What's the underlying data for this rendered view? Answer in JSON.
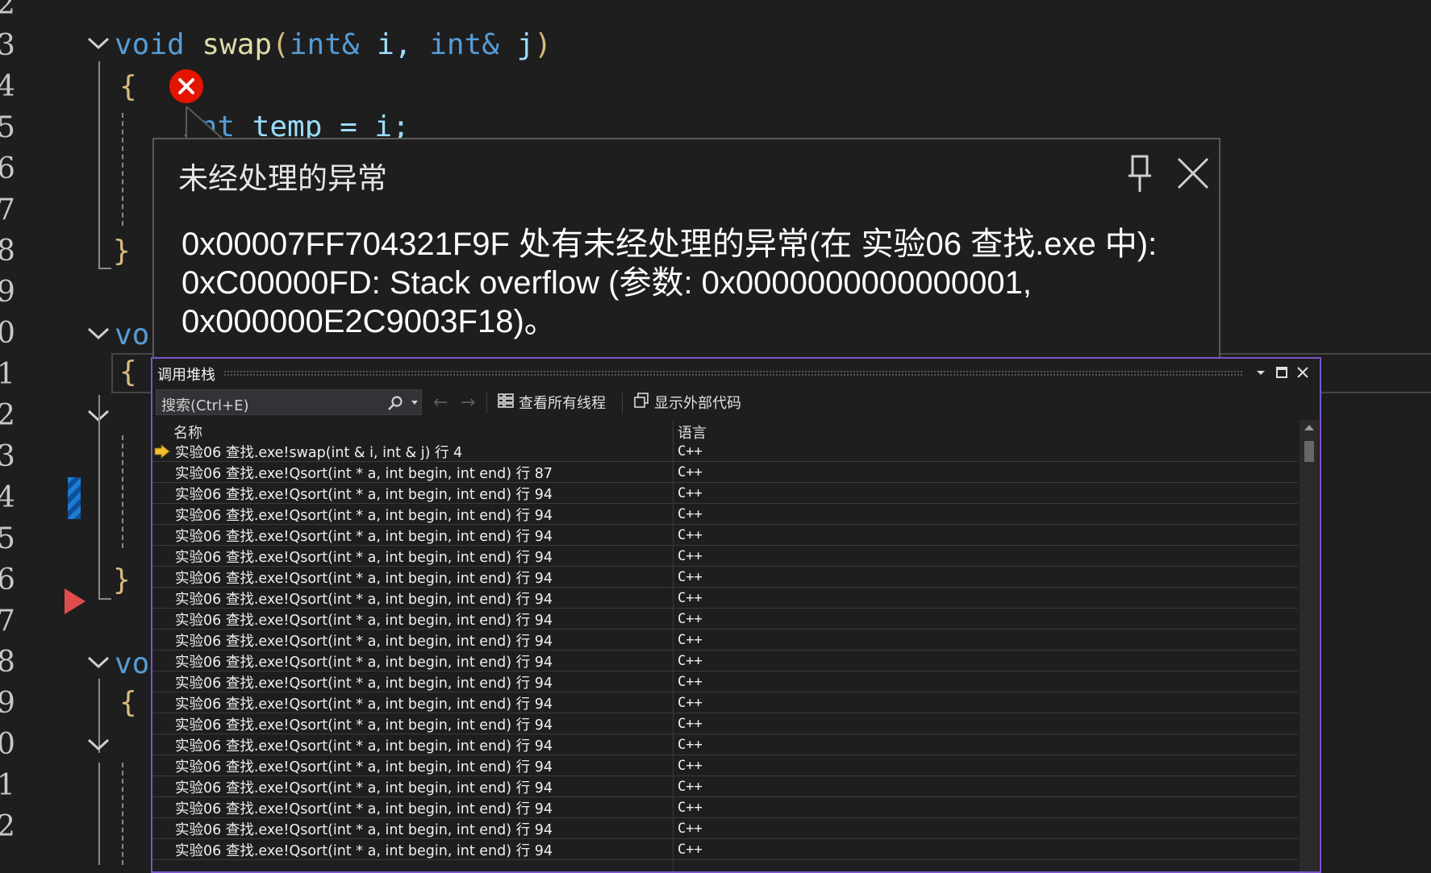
{
  "editor": {
    "line_numbers": [
      "2",
      "3",
      "4",
      "5",
      "6",
      "7",
      "8",
      "9",
      "0",
      "1",
      "2",
      "3",
      "4",
      "5",
      "6",
      "7",
      "8",
      "9",
      "0",
      "1",
      "2"
    ],
    "code": {
      "swap_kw": "void",
      "swap_name": "swap",
      "swap_open": "(",
      "swap_t1": "int&",
      "swap_p1": " i,",
      "swap_t2": "int&",
      "swap_p2": " j",
      "swap_close": ")",
      "brace_open": "{",
      "brace_close": "}",
      "temp_kw": "int",
      "temp_rest": " temp = i;",
      "vo": "vo"
    }
  },
  "exception_popup": {
    "title": "未经处理的异常",
    "message": "0x00007FF704321F9F 处有未经处理的异常(在 实验06 查找.exe 中): 0xC00000FD: Stack overflow (参数: 0x0000000000000001, 0x000000E2C9003F18)。"
  },
  "callstack": {
    "title": "调用堆栈",
    "search_placeholder": "搜索(Ctrl+E)",
    "view_all_threads": "查看所有线程",
    "show_external_code": "显示外部代码",
    "columns": [
      "名称",
      "语言"
    ],
    "rows": [
      {
        "name": "实验06 查找.exe!swap(int & i, int & j) 行 4",
        "lang": "C++",
        "current": true
      },
      {
        "name": "实验06 查找.exe!Qsort(int * a, int begin, int end) 行 87",
        "lang": "C++"
      },
      {
        "name": "实验06 查找.exe!Qsort(int * a, int begin, int end) 行 94",
        "lang": "C++"
      },
      {
        "name": "实验06 查找.exe!Qsort(int * a, int begin, int end) 行 94",
        "lang": "C++"
      },
      {
        "name": "实验06 查找.exe!Qsort(int * a, int begin, int end) 行 94",
        "lang": "C++"
      },
      {
        "name": "实验06 查找.exe!Qsort(int * a, int begin, int end) 行 94",
        "lang": "C++"
      },
      {
        "name": "实验06 查找.exe!Qsort(int * a, int begin, int end) 行 94",
        "lang": "C++"
      },
      {
        "name": "实验06 查找.exe!Qsort(int * a, int begin, int end) 行 94",
        "lang": "C++"
      },
      {
        "name": "实验06 查找.exe!Qsort(int * a, int begin, int end) 行 94",
        "lang": "C++"
      },
      {
        "name": "实验06 查找.exe!Qsort(int * a, int begin, int end) 行 94",
        "lang": "C++"
      },
      {
        "name": "实验06 查找.exe!Qsort(int * a, int begin, int end) 行 94",
        "lang": "C++"
      },
      {
        "name": "实验06 查找.exe!Qsort(int * a, int begin, int end) 行 94",
        "lang": "C++"
      },
      {
        "name": "实验06 查找.exe!Qsort(int * a, int begin, int end) 行 94",
        "lang": "C++"
      },
      {
        "name": "实验06 查找.exe!Qsort(int * a, int begin, int end) 行 94",
        "lang": "C++"
      },
      {
        "name": "实验06 查找.exe!Qsort(int * a, int begin, int end) 行 94",
        "lang": "C++"
      },
      {
        "name": "实验06 查找.exe!Qsort(int * a, int begin, int end) 行 94",
        "lang": "C++"
      },
      {
        "name": "实验06 查找.exe!Qsort(int * a, int begin, int end) 行 94",
        "lang": "C++"
      },
      {
        "name": "实验06 查找.exe!Qsort(int * a, int begin, int end) 行 94",
        "lang": "C++"
      },
      {
        "name": "实验06 查找.exe!Qsort(int * a, int begin, int end) 行 94",
        "lang": "C++"
      },
      {
        "name": "实验06 查找.exe!Qsort(int * a, int begin, int end) 行 94",
        "lang": "C++"
      }
    ]
  },
  "colors": {
    "editor_bg": "#1e1e1e",
    "keyword": "#569cd6",
    "function": "#dcdcaa",
    "error_red": "#e51400",
    "callstack_border": "#7b55c8"
  }
}
